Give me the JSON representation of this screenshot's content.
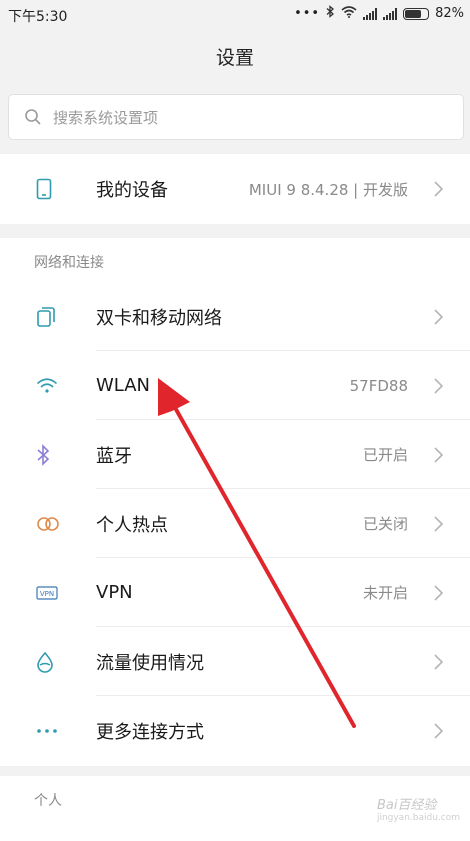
{
  "status_bar": {
    "time": "下午5:30",
    "battery": "82%",
    "battery_level": 0.82
  },
  "header": {
    "title": "设置"
  },
  "search": {
    "placeholder": "搜索系统设置项"
  },
  "device": {
    "label": "我的设备",
    "value": "MIUI 9 8.4.28 | 开发版",
    "icon": "phone-icon"
  },
  "network_section": {
    "title": "网络和连接",
    "items": [
      {
        "label": "双卡和移动网络",
        "value": "",
        "icon": "sim-icon"
      },
      {
        "label": "WLAN",
        "value": "57FD88",
        "icon": "wifi-icon"
      },
      {
        "label": "蓝牙",
        "value": "已开启",
        "icon": "bluetooth-icon"
      },
      {
        "label": "个人热点",
        "value": "已关闭",
        "icon": "hotspot-icon"
      },
      {
        "label": "VPN",
        "value": "未开启",
        "icon": "vpn-icon"
      },
      {
        "label": "流量使用情况",
        "value": "",
        "icon": "data-usage-icon"
      },
      {
        "label": "更多连接方式",
        "value": "",
        "icon": "more-icon"
      }
    ]
  },
  "personal_section": {
    "title": "个人"
  },
  "watermark": {
    "text": "Bai百经验",
    "sub": "jingyan.baidu.com"
  },
  "colors": {
    "accent": "#2f9bb0",
    "arrow": "#e0262c"
  }
}
